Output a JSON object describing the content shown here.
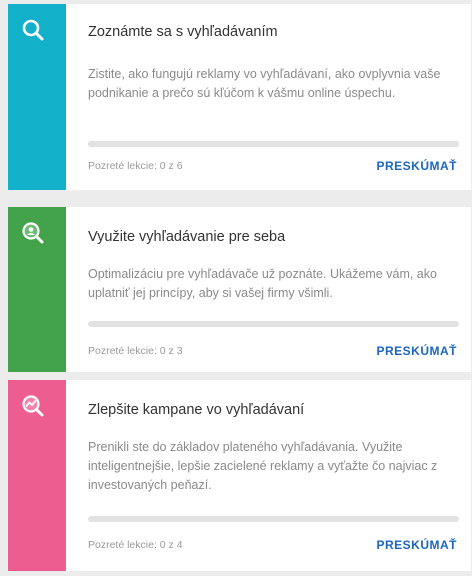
{
  "cards": [
    {
      "title": "Zoznámte sa s vyhľadávaním",
      "description": "Zistite, ako fungujú reklamy vo vyhľadávaní, ako ovplyvnia vaše podnikanie a prečo sú kľúčom k vášmu online úspechu.",
      "lessons": "Pozreté lekcie: 0 z 6",
      "progress_fraction": 0,
      "action": "PRESKÚMAŤ",
      "color": "#12b0c9",
      "icon": "magnifier-icon"
    },
    {
      "title": "Využite vyhľadávanie pre seba",
      "description": "Optimalizáciu pre vyhľadávače už poznáte. Ukážeme vám, ako uplatniť jej princípy, aby si vašej firmy všimli.",
      "lessons": "Pozreté lekcie: 0 z 3",
      "progress_fraction": 0,
      "action": "PRESKÚMAŤ",
      "color": "#43a34a",
      "icon": "person-magnifier-icon"
    },
    {
      "title": "Zlepšite kampane vo vyhľadávaní",
      "description": "Prenikli ste do základov plateného vyhľadávania. Využite inteligentnejšie, lepšie zacielené reklamy a vyťažte čo najviac z investovaných peňazí.",
      "lessons": "Pozreté lekcie: 0 z 4",
      "progress_fraction": 0,
      "action": "PRESKÚMAŤ",
      "color": "#ee5d8f",
      "icon": "trend-magnifier-icon"
    }
  ]
}
